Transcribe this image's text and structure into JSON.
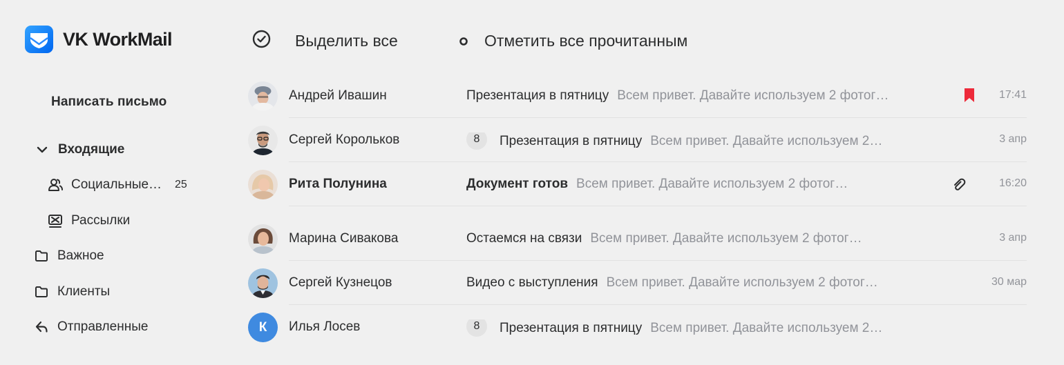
{
  "app": {
    "name": "VK WorkMail"
  },
  "colors": {
    "accent": "#0077ff",
    "flag": "#ed2a3a",
    "avatar_letter_bg": "#3f8ae0",
    "snippet": "#919399"
  },
  "sidebar": {
    "compose_label": "Написать письмо",
    "items": [
      {
        "label": "Входящие",
        "icon": "chevron-down-icon"
      },
      {
        "label": "Социальные…",
        "count": "25",
        "icon": "social-icon"
      },
      {
        "label": "Рассылки",
        "icon": "mailing-icon"
      },
      {
        "label": "Важное",
        "icon": "folder-icon"
      },
      {
        "label": "Клиенты",
        "icon": "folder-icon"
      },
      {
        "label": "Отправленные",
        "icon": "sent-icon"
      }
    ]
  },
  "toolbar": {
    "select_all": "Выделить все",
    "mark_all_read": "Отметить все прочитанным"
  },
  "messages": [
    {
      "sender": "Андрей Ивашин",
      "subject": "Презентация в пятницу",
      "snippet": "Всем привет. Давайте используем 2 фотог…",
      "time": "17:41",
      "flagged": true,
      "unread": false
    },
    {
      "sender": "Сергей Корольков",
      "thread_count": "8",
      "subject": "Презентация в пятницу",
      "snippet": "Всем привет. Давайте используем 2…",
      "time": "3 апр",
      "unread": false
    },
    {
      "sender": "Рита Полунина",
      "subject": "Документ готов",
      "snippet": "Всем привет. Давайте используем 2 фотог…",
      "time": "16:20",
      "attachment": true,
      "unread": true
    },
    {
      "sender": "Марина Сивакова",
      "subject": "Остаемся на связи",
      "snippet": "Всем привет. Давайте используем 2 фотог…",
      "time": "3 апр",
      "unread": false
    },
    {
      "sender": "Сергей Кузнецов",
      "subject": "Видео с выступления",
      "snippet": "Всем привет. Давайте используем 2 фотог…",
      "time": "30 мар",
      "unread": false
    },
    {
      "sender": "Илья Лосев",
      "avatar_letter": "К",
      "thread_count": "8",
      "subject": "Презентация в пятницу",
      "snippet": "Всем привет. Давайте используем 2…",
      "time": "",
      "unread": false
    }
  ]
}
